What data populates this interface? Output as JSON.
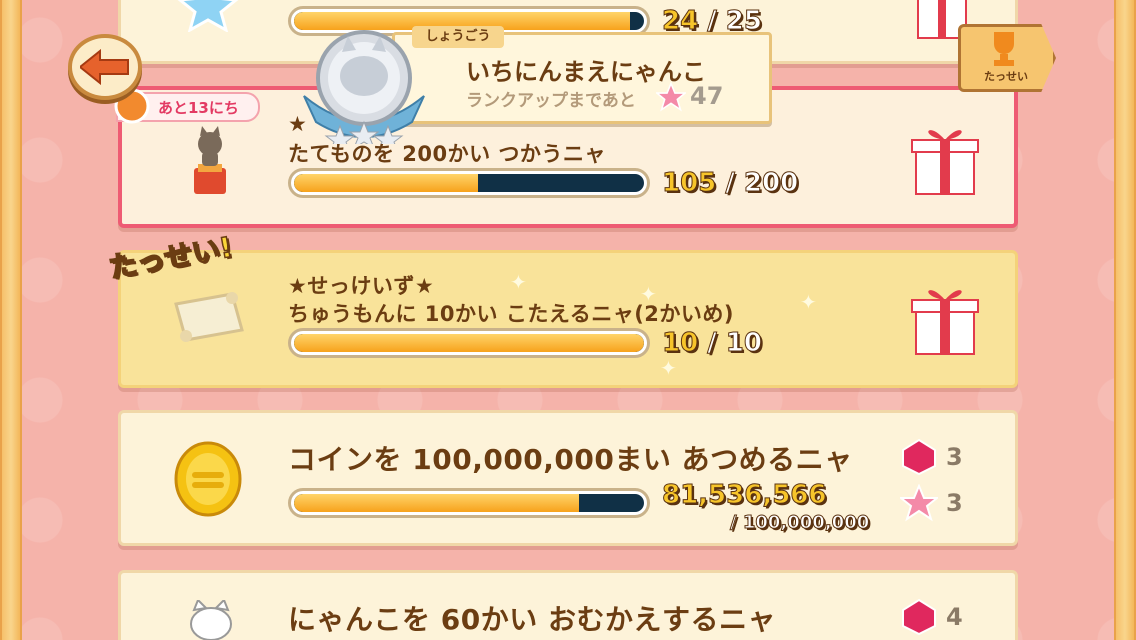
{
  "header": {
    "back_label": "back",
    "trophy_label": "たっせい"
  },
  "rank": {
    "tag": "しょうごう",
    "name": "いちにんまえにゃんこ",
    "next_label": "ランクアップまであと",
    "next_value": "47"
  },
  "missions": [
    {
      "id": "top-partial",
      "title": "",
      "current": "24",
      "total": "25",
      "progress": 0.96,
      "reward": "gift"
    },
    {
      "id": "building-use",
      "days_left": "あと13にち",
      "title_line1": "★",
      "title_line2": "たてものを 200かい つかうニャ",
      "current": "105",
      "total": "200",
      "progress": 0.525,
      "reward": "gift"
    },
    {
      "id": "order-complete",
      "done_stamp": "たっせい!",
      "title_line1": "★せっけいず★",
      "title_line2": "ちゅうもんに 10かい こたえるニャ(2かいめ)",
      "current": "10",
      "total": "10",
      "progress": 1.0,
      "reward": "gift"
    },
    {
      "id": "coins",
      "title": "コインを 100,000,000まい あつめるニャ",
      "current": "81,536,566",
      "total": "/ 100,000,000",
      "progress": 0.815,
      "reward_gem": "3",
      "reward_star": "3"
    },
    {
      "id": "welcome",
      "title": "にゃんこを 60かい おむかえするニャ",
      "reward_gem": "4"
    }
  ],
  "colors": {
    "background": "#f5b3aa",
    "card": "#fdf3d9",
    "card_done": "#f9e39a",
    "expiring_border": "#ee5b73",
    "bar_fill": "#f7a21c",
    "bar_empty": "#103046",
    "text_brown": "#6b3d12"
  }
}
